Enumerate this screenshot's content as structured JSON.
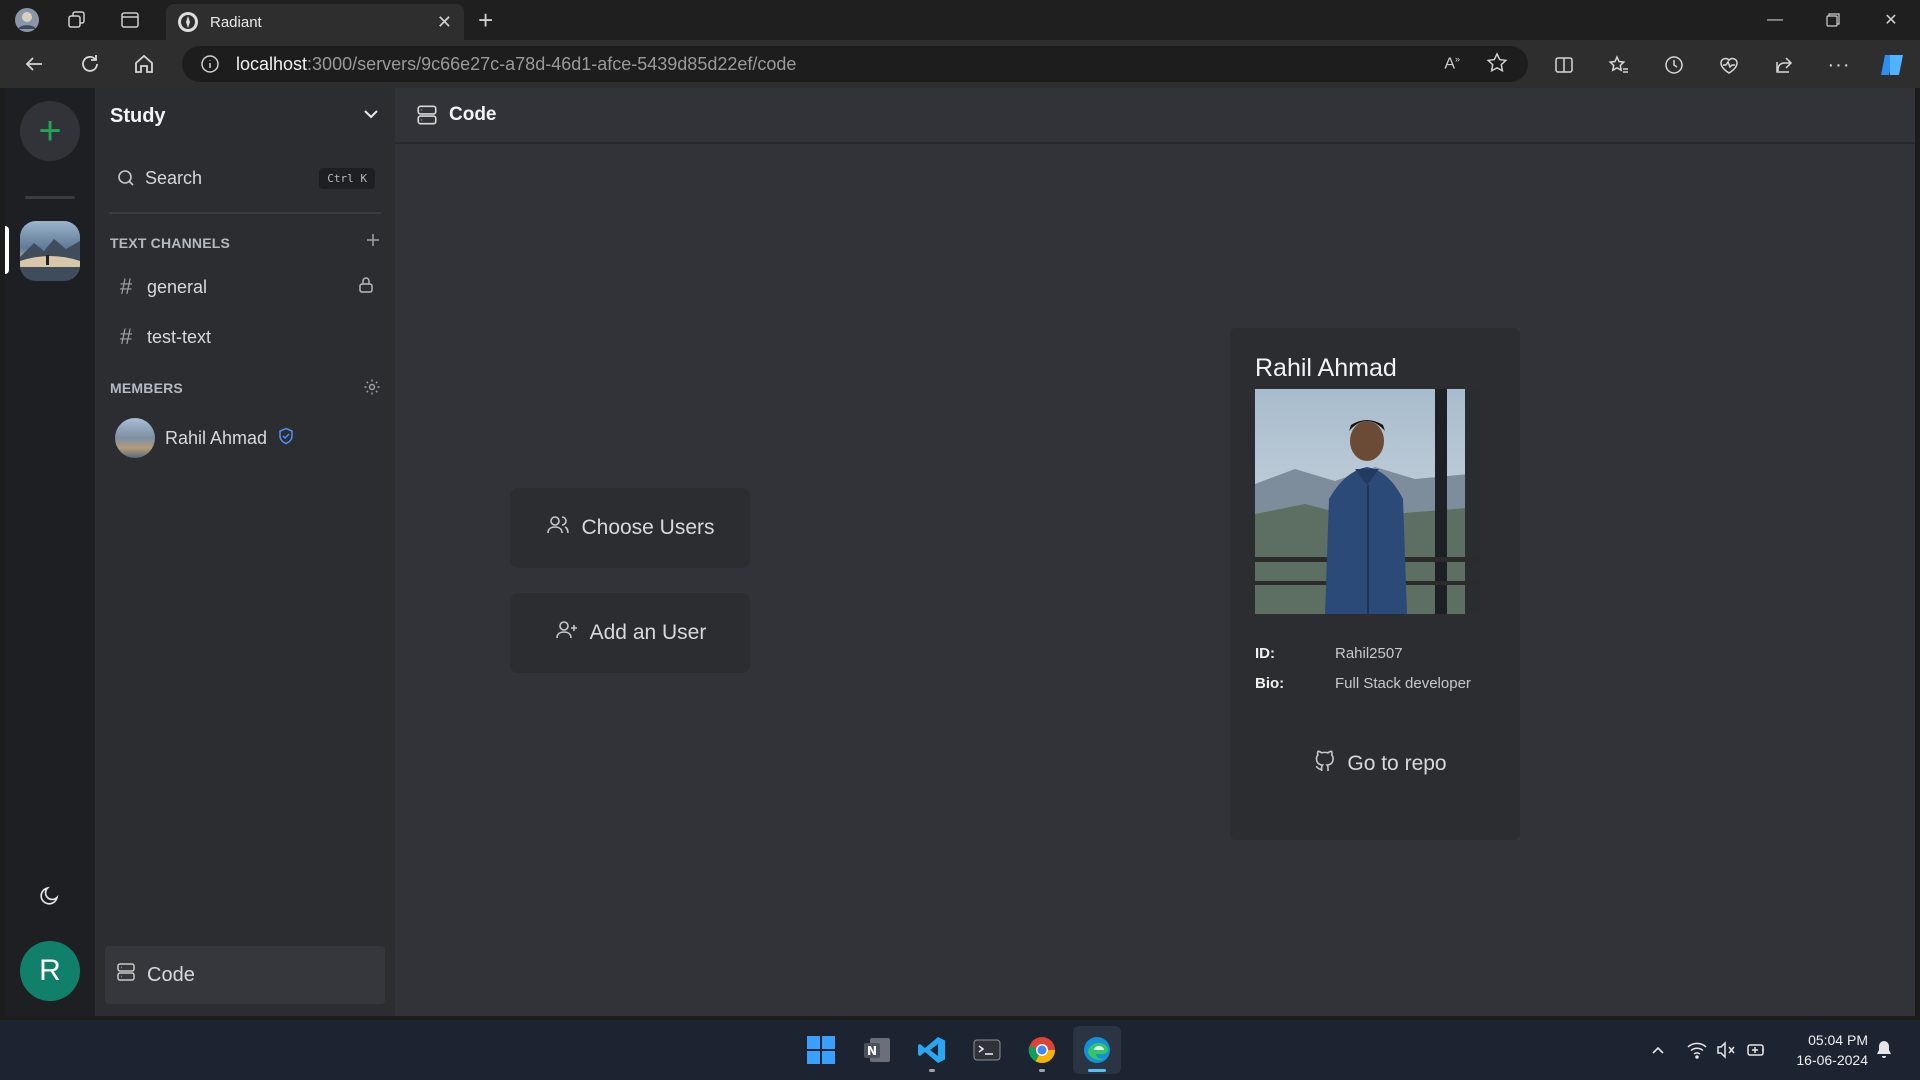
{
  "browser": {
    "tab_title": "Radiant",
    "url_host": "localhost",
    "url_path": ":3000/servers/9c66e27c-a78d-46d1-afce-5439d85d22ef/code"
  },
  "sidebar": {
    "server_name": "Study",
    "search_label": "Search",
    "search_shortcut": "Ctrl K",
    "text_channels_label": "TEXT CHANNELS",
    "channels": [
      {
        "name": "general",
        "locked": true
      },
      {
        "name": "test-text",
        "locked": false
      }
    ],
    "members_label": "MEMBERS",
    "members": [
      {
        "name": "Rahil Ahmad",
        "verified": true
      }
    ],
    "bottom_channel": "Code"
  },
  "rail": {
    "user_initial": "R"
  },
  "main": {
    "header_title": "Code",
    "choose_users_label": "Choose Users",
    "add_user_label": "Add an User"
  },
  "profile": {
    "name": "Rahil Ahmad",
    "id_label": "ID:",
    "id_value": "Rahil2507",
    "bio_label": "Bio:",
    "bio_value": "Full Stack developer",
    "repo_label": "Go to repo"
  },
  "taskbar": {
    "time": "05:04 PM",
    "date": "16-06-2024"
  },
  "colors": {
    "accent_green": "#22a559",
    "user_avatar": "#11806a",
    "app_bg": "#313338",
    "sidebar_bg": "#2b2d31",
    "rail_bg": "#1e1f22"
  }
}
